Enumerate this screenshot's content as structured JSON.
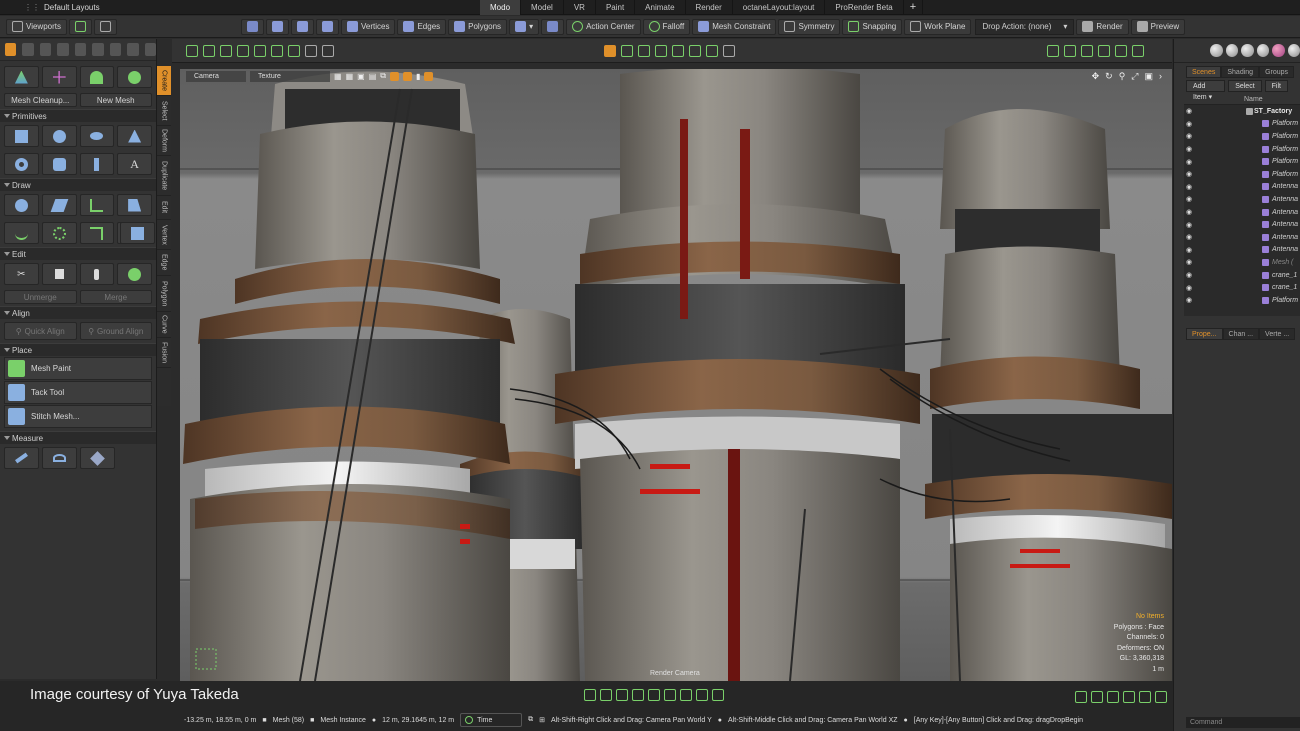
{
  "title_bar": {
    "layout_label": "Default Layouts",
    "tabs": [
      {
        "label": "Modo",
        "active": true
      },
      {
        "label": "Model",
        "active": false
      },
      {
        "label": "VR",
        "active": false
      },
      {
        "label": "Paint",
        "active": false
      },
      {
        "label": "Animate",
        "active": false
      },
      {
        "label": "Render",
        "active": false
      },
      {
        "label": "octaneLayout:layout",
        "active": false
      },
      {
        "label": "ProRender Beta",
        "active": false
      }
    ],
    "add_tab": "+"
  },
  "toolbar": {
    "viewports": "Viewports",
    "vertices": "Vertices",
    "edges": "Edges",
    "polygons": "Polygons",
    "action_center": "Action Center",
    "falloff": "Falloff",
    "mesh_constraint": "Mesh Constraint",
    "symmetry": "Symmetry",
    "snapping": "Snapping",
    "work_plane": "Work Plane",
    "drop_action": "Drop Action: (none)",
    "render": "Render",
    "preview": "Preview"
  },
  "left_panel": {
    "sections": {
      "primitives": "Primitives",
      "draw": "Draw",
      "edit": "Edit",
      "align": "Align",
      "place": "Place",
      "measure": "Measure"
    },
    "mesh_cleanup": "Mesh Cleanup...",
    "new_mesh": "New Mesh",
    "unmerge": "Unmerge",
    "merge": "Merge",
    "quick_align": "Quick Align",
    "ground_align": "Ground Align",
    "mesh_paint": "Mesh Paint",
    "tack_tool": "Tack Tool",
    "stitch_mesh": "Stitch Mesh..."
  },
  "vertical_tabs": [
    "Create",
    "Select",
    "Deform",
    "Duplicate",
    "Edit",
    "Vertex",
    "Edge",
    "Polygon",
    "Curve",
    "Fusion"
  ],
  "viewport": {
    "camera_field": "Camera",
    "texture_field": "Texture",
    "render_camera": "Render Camera",
    "hud": {
      "no_items": "No Items",
      "polygons": "Polygons : Face",
      "channels": "Channels: 0",
      "deformers": "Deformers: ON",
      "gl": "GL: 3,360,318",
      "scale": "1 m"
    }
  },
  "right_panel": {
    "tabs": [
      {
        "label": "Scenes",
        "active": true
      },
      {
        "label": "Shading",
        "active": false
      },
      {
        "label": "Groups",
        "active": false
      }
    ],
    "add_item": "Add Item",
    "select": "Select",
    "filter": "Filt",
    "name_header": "Name",
    "items": [
      {
        "label": "ST_Factory",
        "root": true,
        "dim": false
      },
      {
        "label": "Platform",
        "root": false,
        "dim": false
      },
      {
        "label": "Platform",
        "root": false,
        "dim": false
      },
      {
        "label": "Platform",
        "root": false,
        "dim": false
      },
      {
        "label": "Platform",
        "root": false,
        "dim": false
      },
      {
        "label": "Platform",
        "root": false,
        "dim": false
      },
      {
        "label": "Antenna",
        "root": false,
        "dim": false
      },
      {
        "label": "Antenna",
        "root": false,
        "dim": false
      },
      {
        "label": "Antenna",
        "root": false,
        "dim": false
      },
      {
        "label": "Antenna",
        "root": false,
        "dim": false
      },
      {
        "label": "Antenna",
        "root": false,
        "dim": false
      },
      {
        "label": "Antenna",
        "root": false,
        "dim": false
      },
      {
        "label": "Mesh (",
        "root": false,
        "dim": true
      },
      {
        "label": "crane_1",
        "root": false,
        "dim": false
      },
      {
        "label": "crane_1",
        "root": false,
        "dim": false
      },
      {
        "label": "Platform",
        "root": false,
        "dim": false
      }
    ],
    "bottom_tabs": [
      {
        "label": "Prope...",
        "active": true
      },
      {
        "label": "Chan ...",
        "active": false
      },
      {
        "label": "Verte ...",
        "active": false
      }
    ],
    "command_placeholder": "Command"
  },
  "status_bar": {
    "coords": "-13.25 m, 18.55 m, 0 m",
    "mesh": "Mesh (58)",
    "mesh_instance": "Mesh Instance",
    "instance_coords": "12 m, 29.1645 m, 12 m",
    "time": "Time",
    "hint_1": "Alt-Shift-Right Click and Drag: Camera Pan World Y",
    "hint_2": "Alt-Shift-Middle Click and Drag: Camera Pan World XZ",
    "hint_3": "[Any Key]-[Any Button] Click and Drag: dragDropBegin"
  },
  "credit": "Image courtesy of Yuya Takeda",
  "colors": {
    "accent": "#e0902a",
    "green_icon": "#7ad06a",
    "hud_warning": "#f2b02a",
    "rust": "#7a4a2a",
    "pipe_red": "#8a1d18"
  }
}
